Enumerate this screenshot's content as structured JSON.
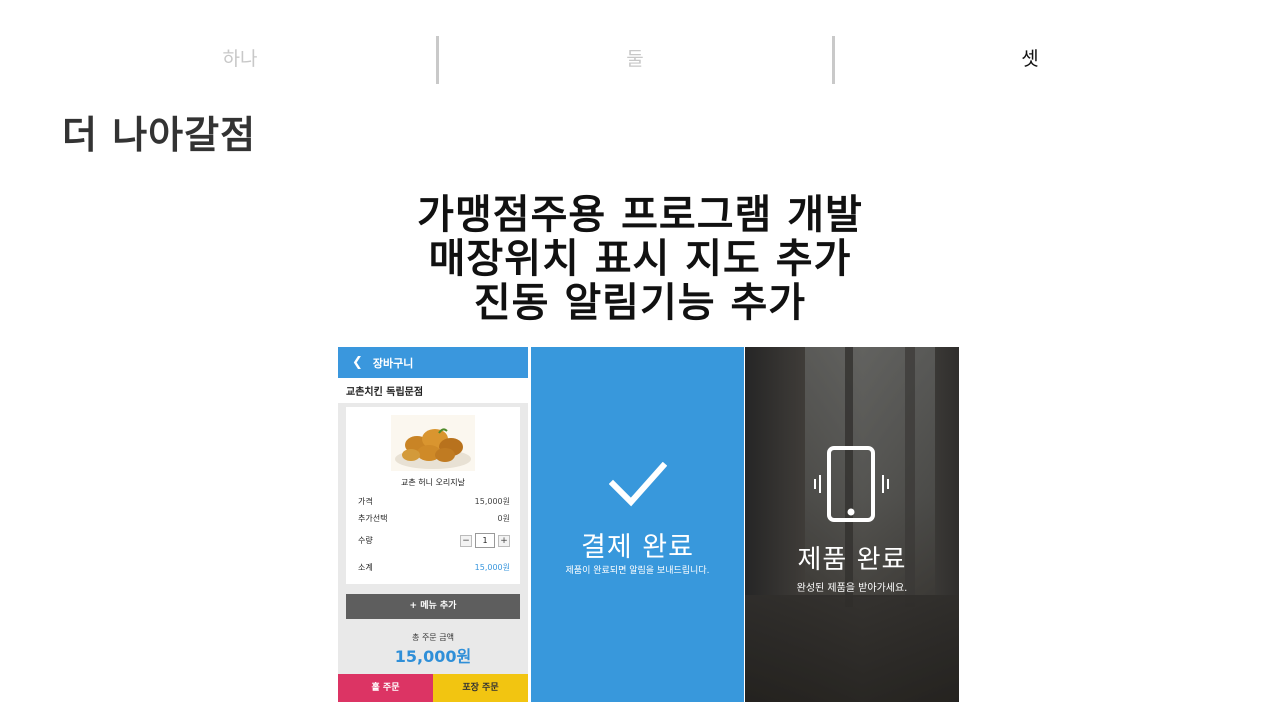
{
  "tabs": [
    {
      "label": "하나",
      "active": false
    },
    {
      "label": "둘",
      "active": false
    },
    {
      "label": "셋",
      "active": true
    }
  ],
  "section_title": "더 나아갈점",
  "headline": [
    "가맹점주용 프로그램 개발",
    "매장위치 표시 지도 추가",
    "진동 알림기능 추가"
  ],
  "cart": {
    "header_title": "장바구니",
    "store_name": "교촌치킨 독립문점",
    "item_name": "교촌 허니 오리지날",
    "price_label": "가격",
    "price_value": "15,000원",
    "option_label": "추가선택",
    "option_value": "0원",
    "qty_label": "수량",
    "qty_value": "1",
    "minus": "−",
    "plus": "+",
    "subtotal_label": "소계",
    "subtotal_value": "15,000원",
    "add_menu": "+ 메뉴 추가",
    "total_label": "총 주문 금액",
    "total_value": "15,000원",
    "hall_order": "홀 주문",
    "pack_order": "포장 주문"
  },
  "payment": {
    "title": "결제 완료",
    "subtitle": "제품이 완료되면 알림을 보내드립니다.",
    "color": "#3898dc"
  },
  "product": {
    "title": "제품 완료",
    "subtitle": "완성된 제품을 받아가세요."
  },
  "colors": {
    "accent_blue": "#3a97dd",
    "hall_pink": "#dc3464",
    "pack_yellow": "#f2c511"
  }
}
